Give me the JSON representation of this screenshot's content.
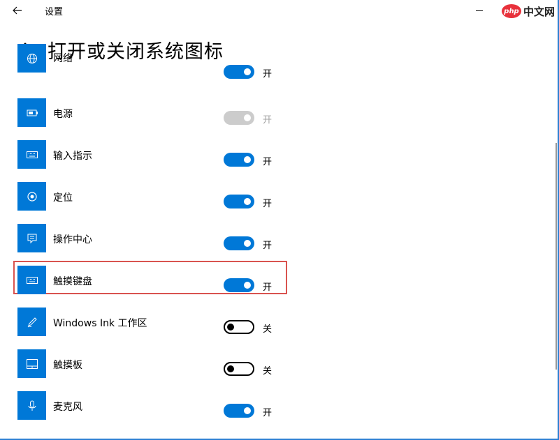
{
  "window": {
    "title": "设置"
  },
  "watermark": {
    "logo": "php",
    "text": "中文网"
  },
  "page": {
    "title": "打开或关闭系统图标"
  },
  "items": [
    {
      "label": "网络",
      "state": "开",
      "on": true,
      "disabled": false,
      "icon": "globe-icon"
    },
    {
      "label": "电源",
      "state": "开",
      "on": true,
      "disabled": true,
      "icon": "battery-icon"
    },
    {
      "label": "输入指示",
      "state": "开",
      "on": true,
      "disabled": false,
      "icon": "keyboard-icon"
    },
    {
      "label": "定位",
      "state": "开",
      "on": true,
      "disabled": false,
      "icon": "location-icon"
    },
    {
      "label": "操作中心",
      "state": "开",
      "on": true,
      "disabled": false,
      "icon": "action-center-icon"
    },
    {
      "label": "触摸键盘",
      "state": "开",
      "on": true,
      "disabled": false,
      "icon": "keyboard-icon"
    },
    {
      "label": "Windows Ink 工作区",
      "state": "关",
      "on": false,
      "disabled": false,
      "icon": "pen-icon"
    },
    {
      "label": "触摸板",
      "state": "关",
      "on": false,
      "disabled": false,
      "icon": "touchpad-icon"
    },
    {
      "label": "麦克风",
      "state": "开",
      "on": true,
      "disabled": false,
      "icon": "microphone-icon"
    }
  ],
  "colors": {
    "accent": "#0078d7",
    "highlight": "#d9534f"
  }
}
